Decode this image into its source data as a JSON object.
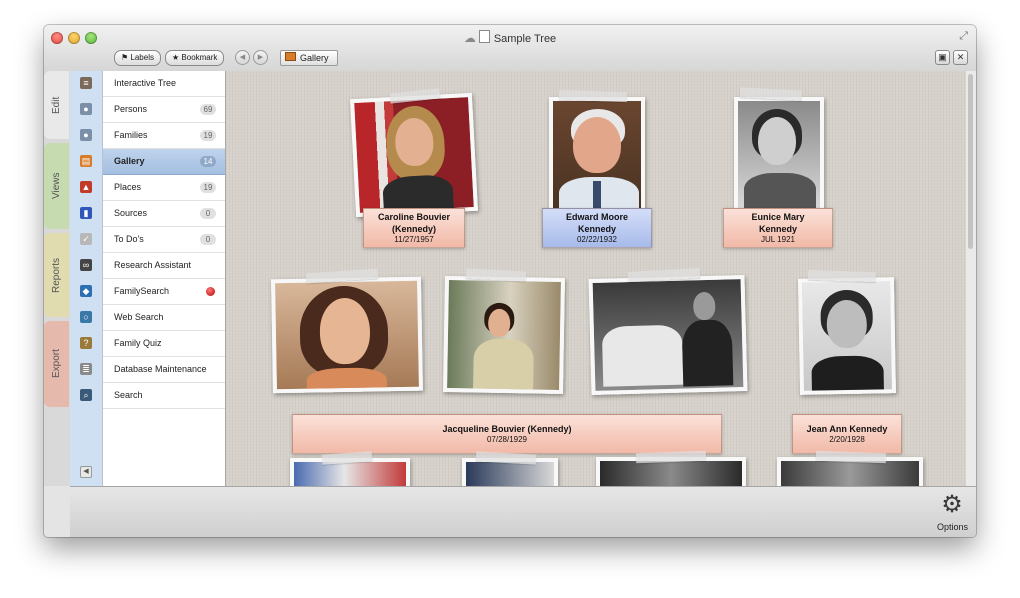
{
  "window": {
    "title": "Sample Tree",
    "toolbar": {
      "labels": "Labels",
      "bookmark": "Bookmark",
      "breadcrumb": "Gallery"
    }
  },
  "tabs": [
    "Edit",
    "Views",
    "Reports",
    "Export"
  ],
  "sidebar": {
    "items": [
      {
        "label": "Interactive Tree",
        "icon": "tree-icon"
      },
      {
        "label": "Persons",
        "count": "69",
        "icon": "person-icon"
      },
      {
        "label": "Families",
        "count": "19",
        "icon": "family-icon"
      },
      {
        "label": "Gallery",
        "count": "14",
        "icon": "gallery-icon",
        "selected": true
      },
      {
        "label": "Places",
        "count": "19",
        "icon": "map-pin-icon"
      },
      {
        "label": "Sources",
        "count": "0",
        "icon": "book-icon"
      },
      {
        "label": "To Do's",
        "count": "0",
        "icon": "checklist-icon"
      },
      {
        "label": "Research Assistant",
        "icon": "binoculars-icon"
      },
      {
        "label": "FamilySearch",
        "icon": "familysearch-icon"
      },
      {
        "label": "Web Search",
        "icon": "globe-search-icon"
      },
      {
        "label": "Family Quiz",
        "icon": "question-icon"
      },
      {
        "label": "Database Maintenance",
        "icon": "database-icon"
      },
      {
        "label": "Search",
        "icon": "magnifier-icon"
      }
    ]
  },
  "gallery": {
    "cards": [
      {
        "name": "Caroline Bouvier (Kennedy)",
        "line1": "Caroline Bouvier",
        "line2": "(Kennedy)",
        "date": "11/27/1957",
        "gender": "female"
      },
      {
        "name": "Edward Moore Kennedy",
        "line1": "Edward Moore",
        "line2": "Kennedy",
        "date": "02/22/1932",
        "gender": "male"
      },
      {
        "name": "Eunice Mary Kennedy",
        "line1": "Eunice Mary",
        "line2": "Kennedy",
        "date": "JUL 1921",
        "gender": "female"
      },
      {
        "name": "Jacqueline Bouvier (Kennedy)",
        "line1": "Jacqueline Bouvier (Kennedy)",
        "date": "07/28/1929",
        "gender": "female"
      },
      {
        "name": "Jean Ann Kennedy",
        "line1": "Jean Ann Kennedy",
        "date": "2/20/1928",
        "gender": "female"
      }
    ]
  },
  "bottom": {
    "options_label": "Options"
  },
  "colors": {
    "selection": "#a9c2e3",
    "female_label": "#f1b9a8",
    "male_label": "#a7baea"
  }
}
